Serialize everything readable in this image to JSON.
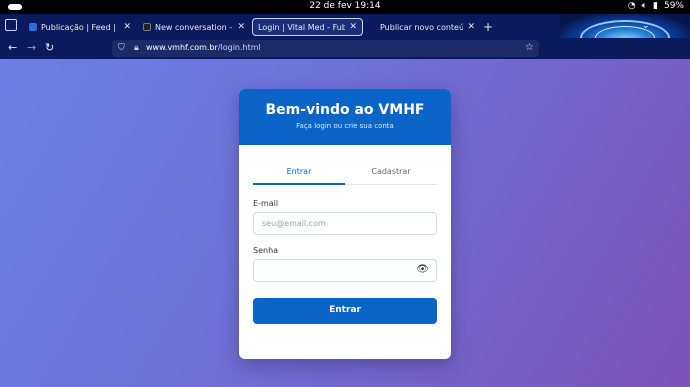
{
  "system": {
    "datetime": "22 de fev 19:14",
    "battery": "59%"
  },
  "browser": {
    "tabs": [
      {
        "label": "Publicação | Feed | LinkedIn",
        "favicon": "linkedin-icon",
        "color": "#2d6fd0"
      },
      {
        "label": "New conversation - Grok",
        "favicon": "grok-icon",
        "color": "#222222"
      },
      {
        "label": "Login | Vital Med - Fuben",
        "favicon": "none",
        "color": "#1a2e7a"
      },
      {
        "label": "Publicar novo conteúdo ·",
        "favicon": "none",
        "color": "#0b1a5c"
      }
    ],
    "url_host": "www.vmhf.com.br",
    "url_path": "/login.html"
  },
  "card": {
    "title": "Bem-vindo ao VMHF",
    "subtitle": "Faça login ou crie sua conta",
    "tabs": {
      "login": "Entrar",
      "register": "Cadastrar"
    },
    "email_label": "E-mail",
    "email_placeholder": "seu@email.com",
    "password_label": "Senha",
    "submit_label": "Entrar"
  },
  "colors": {
    "accent": "#0b64c8",
    "bg_start": "#6b7fe6",
    "bg_end": "#7b54b6"
  }
}
